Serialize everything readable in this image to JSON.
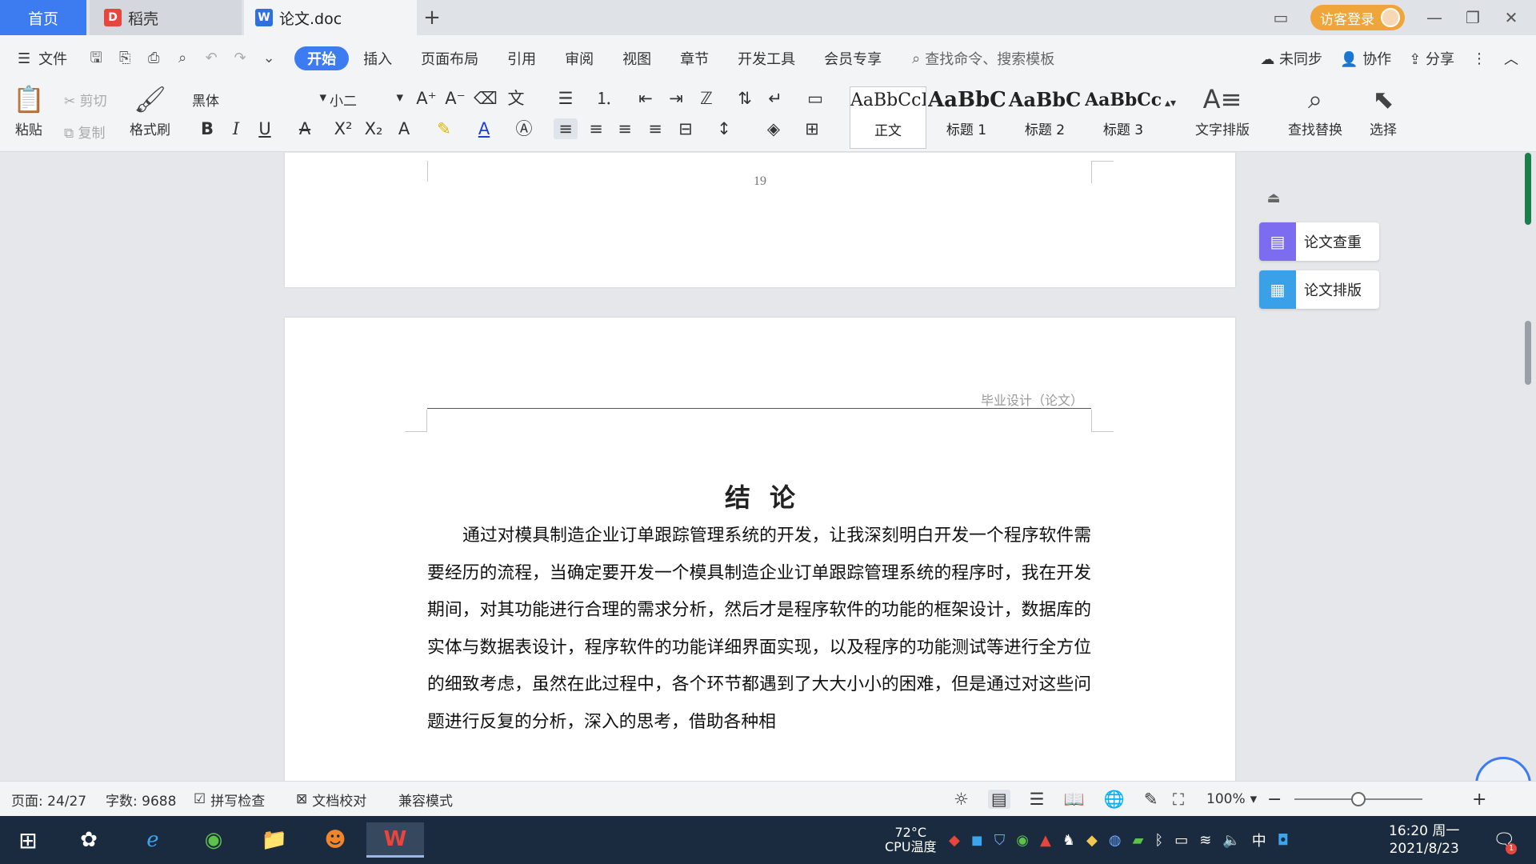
{
  "tabs": {
    "home": "首页",
    "daoke": "稻壳",
    "doc": "论文.doc",
    "login": "访客登录"
  },
  "menu": {
    "file": "文件",
    "items": [
      "开始",
      "插入",
      "页面布局",
      "引用",
      "审阅",
      "视图",
      "章节",
      "开发工具",
      "会员专享"
    ],
    "search_placeholder": "查找命令、搜索模板",
    "unsynced": "未同步",
    "collab": "协作",
    "share": "分享"
  },
  "ribbon": {
    "paste": "粘贴",
    "cut": "剪切",
    "copy": "复制",
    "format_painter": "格式刷",
    "font_name": "黑体",
    "font_size": "小二",
    "styles": [
      {
        "sample": "AaBbCcDd",
        "name": "正文"
      },
      {
        "sample": "AaBbC",
        "name": "标题 1"
      },
      {
        "sample": "AaBbC",
        "name": "标题 2"
      },
      {
        "sample": "AaBbCcI",
        "name": "标题 3"
      }
    ],
    "text_layout": "文字排版",
    "find_replace": "查找替换",
    "select": "选择"
  },
  "document": {
    "page_number": "19",
    "header_text": "毕业设计（论文）",
    "heading": "结论",
    "body": "通过对模具制造企业订单跟踪管理系统的开发，让我深刻明白开发一个程序软件需要经历的流程，当确定要开发一个模具制造企业订单跟踪管理系统的程序时，我在开发期间，对其功能进行合理的需求分析，然后才是程序软件的功能的框架设计，数据库的实体与数据表设计，程序软件的功能详细界面实现，以及程序的功能测试等进行全方位的细致考虑，虽然在此过程中，各个环节都遇到了大大小小的困难，但是通过对这些问题进行反复的分析，深入的思考，借助各种相"
  },
  "side_panel": {
    "check": "论文查重",
    "layout": "论文排版"
  },
  "status": {
    "page": "页面: 24/27",
    "word_count": "字数: 9688",
    "spell_check": "拼写检查",
    "doc_proof": "文档校对",
    "compat_mode": "兼容模式",
    "zoom": "100%",
    "zoom_fraction": 0.5
  },
  "taskbar": {
    "cpu_temp": "72°C",
    "cpu_label": "CPU温度",
    "ime": "中",
    "time": "16:20 周一",
    "date": "2021/8/23",
    "notif_count": "1"
  },
  "colors": {
    "accent": "#3d7bf0",
    "login": "#f0a53a",
    "taskbar": "#1b2b3f",
    "check_card": "#7b6cf0",
    "layout_card": "#3aa0e8"
  }
}
